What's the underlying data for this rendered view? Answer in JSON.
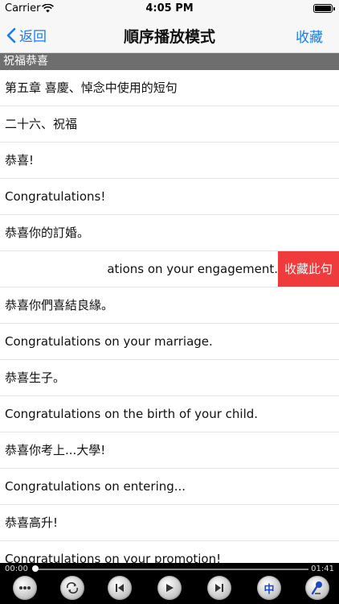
{
  "status_bar": {
    "carrier": "Carrier",
    "time": "4:05 PM"
  },
  "nav": {
    "back_label": "返回",
    "title": "順序播放模式",
    "favorite_label": "收藏"
  },
  "section": {
    "title": "祝福恭喜"
  },
  "rows": [
    {
      "text": "第五章  喜慶、悼念中使用的短句"
    },
    {
      "text": "二十六、祝福"
    },
    {
      "text": "恭喜!"
    },
    {
      "text": "Congratulations!"
    },
    {
      "text": "恭喜你的訂婚。"
    },
    {
      "text": "ations on your engagement.",
      "action": "收藏此句"
    },
    {
      "text": "恭喜你們喜結良緣。"
    },
    {
      "text": "Congratulations on your marriage."
    },
    {
      "text": "恭喜生子。"
    },
    {
      "text": "Congratulations on the birth of your child."
    },
    {
      "text": "恭喜你考上...大學!"
    },
    {
      "text": "Congratulations on entering..."
    },
    {
      "text": "恭喜高升!"
    },
    {
      "text": "Congratulations on your promotion!"
    }
  ],
  "player": {
    "current_time": "00:00",
    "duration": "01:41",
    "progress": 0,
    "language_button": "中",
    "icons": [
      "more-icon",
      "repeat-icon",
      "previous-icon",
      "play-icon",
      "next-icon",
      "language-icon",
      "microphone-icon"
    ]
  },
  "colors": {
    "accent": "#1a7cf5",
    "section_bg": "#6e6e6e",
    "swipe_action": "#ef3b3b",
    "player_bg": "#000000"
  }
}
